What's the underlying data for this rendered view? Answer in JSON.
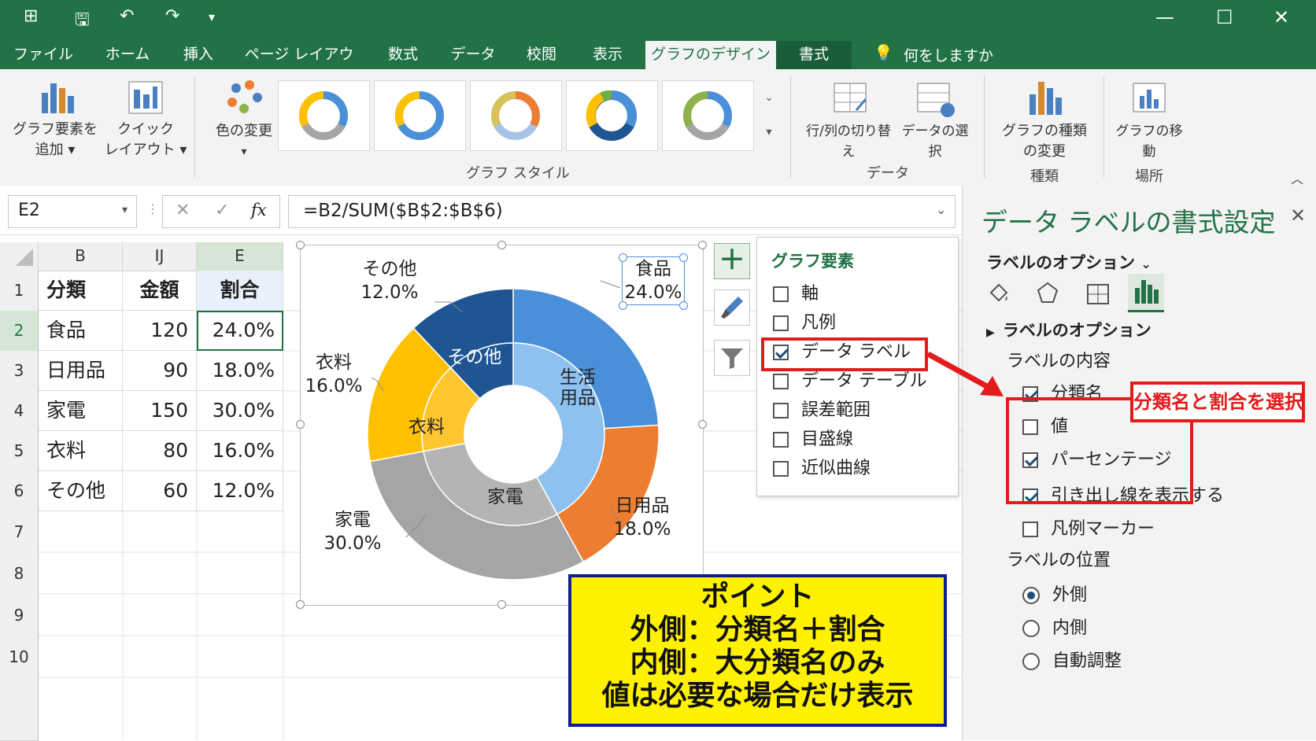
{
  "quick_access": {
    "save_icon": "save-icon",
    "undo_icon": "undo-icon",
    "redo_icon": "redo-icon"
  },
  "tabs": [
    {
      "label": "ファイル"
    },
    {
      "label": "ホーム"
    },
    {
      "label": "挿入"
    },
    {
      "label": "ページ レイアウト"
    },
    {
      "label": "数式"
    },
    {
      "label": "データ"
    },
    {
      "label": "校閲"
    },
    {
      "label": "表示"
    },
    {
      "label": "グラフのデザイン",
      "active": true
    },
    {
      "label": "書式"
    }
  ],
  "tell_me": "何をしますか",
  "ribbon": {
    "add_element": [
      "グラフ要素を",
      "追加 ▾"
    ],
    "quick_layout": [
      "クイック",
      "レイアウト ▾"
    ],
    "change_color": [
      "色の変更",
      "▾"
    ],
    "styles_group": "グラフ スタイル",
    "switch_row_col": "行/列の切り替え",
    "select_data": "データの選択",
    "data_group": "データ",
    "change_type": [
      "グラフの種類",
      "の変更"
    ],
    "type_group": "種類",
    "move_chart": "グラフの移動",
    "location_group": "場所"
  },
  "formula_bar": {
    "name_box": "E2",
    "formula": "=B2/SUM($B$2:$B$6)",
    "fx": "fx"
  },
  "sheet": {
    "columns": [
      "B",
      "IJ",
      "E"
    ],
    "rows": [
      {
        "n": "1",
        "cat": "分類",
        "amt": "金額",
        "pct": "割合"
      },
      {
        "n": "2",
        "cat": "食品",
        "amt": "120",
        "pct": "24.0%"
      },
      {
        "n": "3",
        "cat": "日用品",
        "amt": "90",
        "pct": "18.0%"
      },
      {
        "n": "4",
        "cat": "家電",
        "amt": "150",
        "pct": "30.0%"
      },
      {
        "n": "5",
        "cat": "衣料",
        "amt": "80",
        "pct": "16.0%"
      },
      {
        "n": "6",
        "cat": "その他",
        "amt": "60",
        "pct": "12.0%"
      },
      {
        "n": "7"
      },
      {
        "n": "8"
      },
      {
        "n": "9"
      },
      {
        "n": "10"
      }
    ]
  },
  "chart_data": {
    "type": "pie",
    "subtype": "double doughnut",
    "outer_ring": {
      "categories": [
        "食品",
        "日用品",
        "家電",
        "衣料",
        "その他"
      ],
      "values": [
        24.0,
        18.0,
        30.0,
        16.0,
        12.0
      ],
      "labels": [
        {
          "name": "食品",
          "pct": "24.0%"
        },
        {
          "name": "日用品",
          "pct": "18.0%"
        },
        {
          "name": "家電",
          "pct": "30.0%"
        },
        {
          "name": "衣料",
          "pct": "16.0%"
        },
        {
          "name": "その他",
          "pct": "12.0%"
        }
      ],
      "colors": [
        "#4a90d9",
        "#ed7d31",
        "#a5a5a5",
        "#ffc000",
        "#1f5592"
      ]
    },
    "inner_ring": {
      "categories": [
        "生活用品",
        "家電",
        "衣料",
        "その他"
      ],
      "values": [
        42.0,
        30.0,
        16.0,
        12.0
      ],
      "labels": [
        [
          "生活",
          "用品"
        ],
        [
          "家電"
        ],
        [
          "衣料"
        ],
        [
          "その他"
        ]
      ],
      "colors": [
        "#8ec1f0",
        "#b4b4b4",
        "#ffc62e",
        "#1f5592"
      ]
    }
  },
  "chart_elements": {
    "title": "グラフ要素",
    "items": [
      {
        "label": "軸",
        "checked": false
      },
      {
        "label": "凡例",
        "checked": false
      },
      {
        "label": "データ ラベル",
        "checked": true
      },
      {
        "label": "データ テーブル",
        "checked": false
      },
      {
        "label": "誤差範囲",
        "checked": false
      },
      {
        "label": "目盛線",
        "checked": false
      },
      {
        "label": "近似曲線",
        "checked": false
      }
    ]
  },
  "pane": {
    "title": "データ ラベルの書式設定",
    "options_dropdown": "ラベルのオプション",
    "section": "ラベルのオプション",
    "contents_heading": "ラベルの内容",
    "contents": [
      {
        "label": "分類名",
        "checked": true
      },
      {
        "label": "値",
        "checked": false
      },
      {
        "label": "パーセンテージ",
        "checked": true
      },
      {
        "label": "引き出し線を表示する",
        "checked": true
      },
      {
        "label": "凡例マーカー",
        "checked": false
      }
    ],
    "position_heading": "ラベルの位置",
    "positions": [
      {
        "label": "外側",
        "selected": true
      },
      {
        "label": "内側",
        "selected": false
      },
      {
        "label": "自動調整",
        "selected": false
      }
    ]
  },
  "annotation": {
    "red_callout": "分類名と割合を選択"
  },
  "point_box": [
    "ポイント",
    "外側：分類名＋割合",
    "内側：大分類名のみ",
    "値は必要な場合だけ表示"
  ]
}
